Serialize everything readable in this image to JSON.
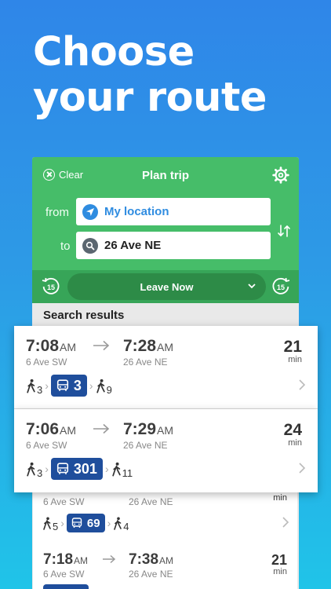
{
  "headline": {
    "line1": "Choose",
    "line2": "your route"
  },
  "plan": {
    "clear_label": "Clear",
    "title": "Plan trip",
    "from_label": "from",
    "to_label": "to",
    "from_value": "My location",
    "to_value": "26 Ave NE",
    "leave_label": "Leave Now",
    "back_offset": "15",
    "forward_offset": "15"
  },
  "results": {
    "title": "Search results",
    "items": [
      {
        "depart": "7:08",
        "depart_ampm": "AM",
        "arrive": "7:28",
        "arrive_ampm": "AM",
        "from_stop": "6 Ave SW",
        "to_stop": "26 Ave NE",
        "duration": "21",
        "duration_unit": "min",
        "walk_before": "3",
        "route": "3",
        "walk_after": "9"
      },
      {
        "depart": "7:06",
        "depart_ampm": "AM",
        "arrive": "7:29",
        "arrive_ampm": "AM",
        "from_stop": "6 Ave SW",
        "to_stop": "26 Ave NE",
        "duration": "24",
        "duration_unit": "min",
        "walk_before": "3",
        "route": "301",
        "walk_after": "11"
      },
      {
        "from_stop": "6 Ave SW",
        "to_stop": "26 Ave NE",
        "duration_unit": "min",
        "walk_before": "5",
        "route": "69",
        "walk_after": "4"
      },
      {
        "depart": "7:18",
        "depart_ampm": "AM",
        "arrive": "7:38",
        "arrive_ampm": "AM",
        "from_stop": "6 Ave SW",
        "to_stop": "26 Ave NE",
        "duration": "21",
        "duration_unit": "min"
      }
    ]
  },
  "colors": {
    "header_green": "#46bd69",
    "leave_bar": "#37a558",
    "bus_badge": "#1f4e9c",
    "location_blue": "#2f8ce0"
  }
}
